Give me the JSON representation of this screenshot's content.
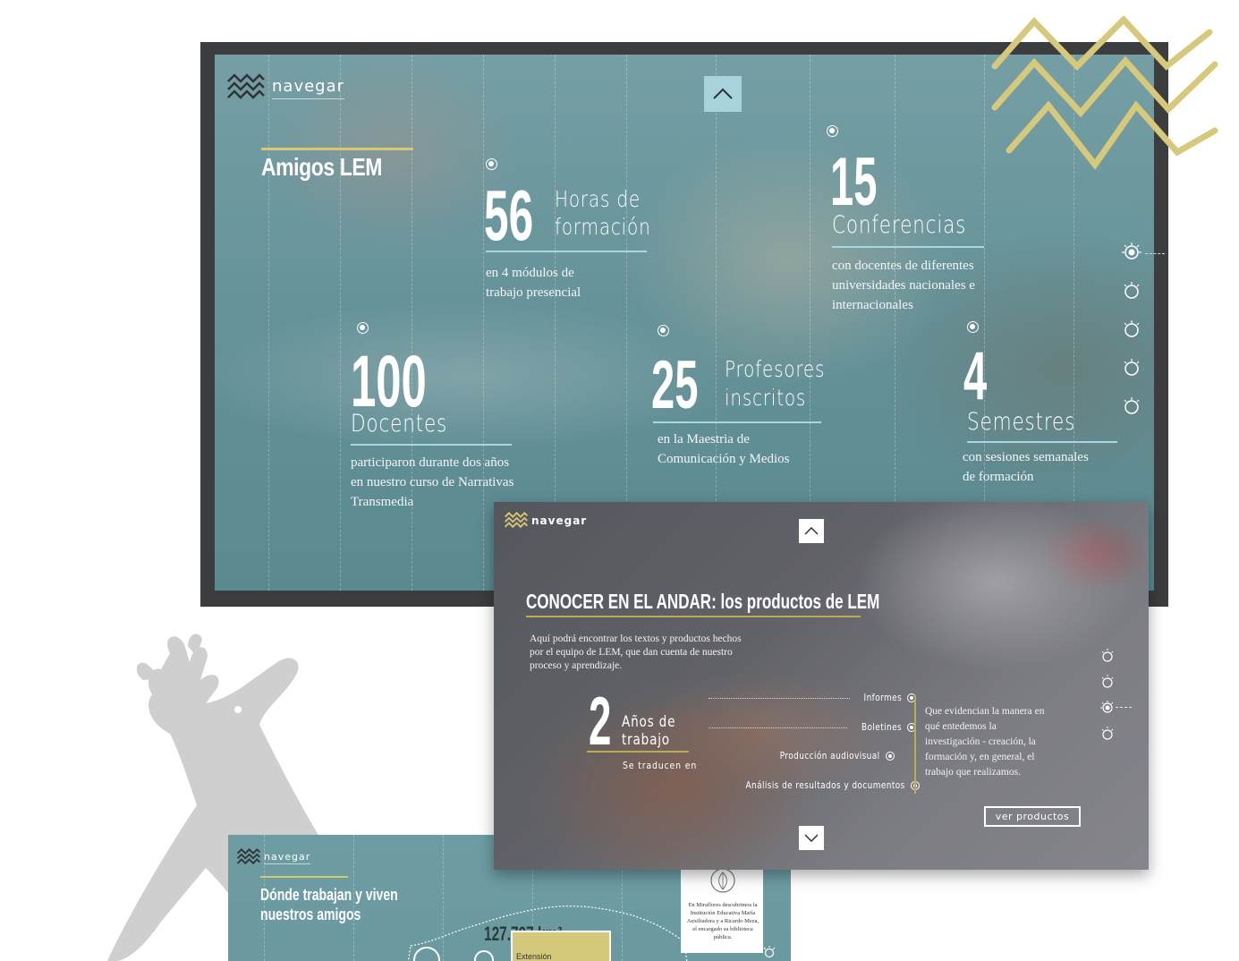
{
  "brand": {
    "logo_text": "navegar"
  },
  "screen1": {
    "title": "Amigos LEM",
    "stats": [
      {
        "id": "horas",
        "number": "56",
        "label_line1": "Horas de",
        "label_line2": "formación",
        "desc_line1": "en 4 módulos de",
        "desc_line2": "trabajo presencial"
      },
      {
        "id": "conferencias",
        "number": "15",
        "label_line1": "Conferencias",
        "desc_line1": "con docentes de diferentes",
        "desc_line2": "universidades nacionales e",
        "desc_line3": "internacionales"
      },
      {
        "id": "docentes",
        "number": "100",
        "label_line1": "Docentes",
        "desc_line1": "participaron durante dos años",
        "desc_line2": "en nuestro curso de Narrativas",
        "desc_line3": "Transmedia"
      },
      {
        "id": "profesores",
        "number": "25",
        "label_line1": "Profesores",
        "label_line2": "inscritos",
        "desc_line1": "en la Maestria de",
        "desc_line2": "Comunicación y Medios"
      },
      {
        "id": "semestres",
        "number": "4",
        "label_line1": "Semestres",
        "desc_line1": "con sesiones semanales",
        "desc_line2": "de formación"
      }
    ],
    "side_nav_count": 5,
    "side_nav_active": 0
  },
  "screen2": {
    "title": "CONOCER EN EL ANDAR: los productos de LEM",
    "intro": "Aquí podrá encontrar los textos y productos hechos por el equipo de LEM, que dan cuenta de nuestro proceso y aprendizaje.",
    "big_number": "2",
    "years_line1": "Años de",
    "years_line2": "trabajo",
    "sub": "Se traducen en",
    "products": [
      "Informes",
      "Boletines",
      "Producción audiovisual",
      "Análisis de resultados y documentos"
    ],
    "right_text": "Que evidencian la manera en qué entedemos la investigación - creación, la formación y, en general, el trabajo que realizamos.",
    "button": "ver productos",
    "side_nav_count": 4,
    "side_nav_active": 2
  },
  "screen3": {
    "title_line1": "Dónde trabajan y viven",
    "title_line2": "nuestros amigos",
    "number": "127.707 km²",
    "box_label": "Extensión",
    "card_text": "En Miraflores descubrimos la Institución Educativa María Auxiliadora y a Ricardo Meza, el encargado su biblioteca pública."
  },
  "colors": {
    "accent_yellow": "#d8c873",
    "accent_teal": "#a6d3dc",
    "gold_rule": "#b9ad51"
  }
}
